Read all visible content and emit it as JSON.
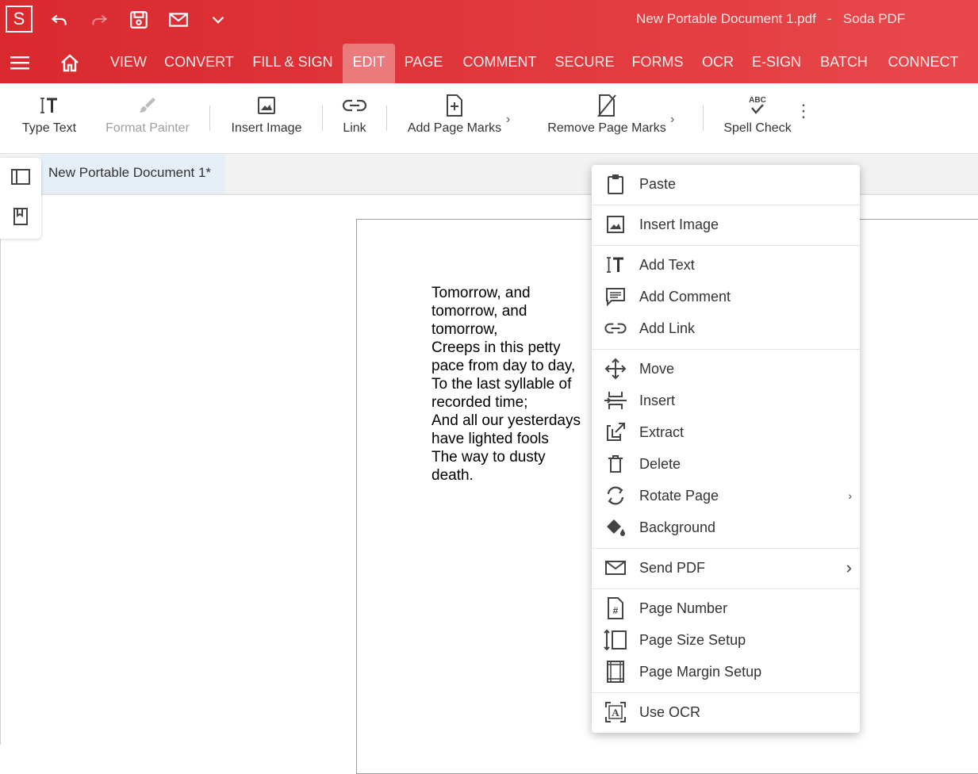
{
  "titlebar": {
    "logo": "S",
    "title": "New Portable Document 1.pdf   -   Soda PDF"
  },
  "tabs": [
    {
      "label": "VIEW"
    },
    {
      "label": "CONVERT"
    },
    {
      "label": "FILL & SIGN"
    },
    {
      "label": "EDIT",
      "active": true
    },
    {
      "label": "PAGE"
    },
    {
      "label": "COMMENT"
    },
    {
      "label": "SECURE"
    },
    {
      "label": "FORMS"
    },
    {
      "label": "OCR"
    },
    {
      "label": "E-SIGN"
    },
    {
      "label": "BATCH"
    },
    {
      "label": "CONNECT"
    }
  ],
  "toolbar": {
    "type_text": "Type Text",
    "format_painter": "Format Painter",
    "insert_image": "Insert Image",
    "link": "Link",
    "add_page_marks": "Add Page Marks",
    "remove_page_marks": "Remove Page Marks",
    "spell_check": "Spell Check",
    "spell_check_icon_text": "ABC"
  },
  "document": {
    "tab_label": "New Portable Document 1*",
    "poem_lines": [
      "Tomorrow, and",
      "tomorrow, and",
      "tomorrow,",
      "Creeps in this petty",
      "pace from day to day,",
      "To the last syllable of",
      "recorded time;",
      "And all our yesterdays",
      "have lighted fools",
      "The way to dusty",
      "death."
    ]
  },
  "context_menu": {
    "paste": "Paste",
    "insert_image": "Insert Image",
    "add_text": "Add Text",
    "add_comment": "Add Comment",
    "add_link": "Add Link",
    "move": "Move",
    "insert": "Insert",
    "extract": "Extract",
    "delete": "Delete",
    "rotate_page": "Rotate Page",
    "background": "Background",
    "send_pdf": "Send PDF",
    "page_number": "Page Number",
    "page_size_setup": "Page Size Setup",
    "page_margin_setup": "Page Margin Setup",
    "use_ocr": "Use OCR",
    "page_number_icon_text": "#",
    "use_ocr_icon_text": "A"
  },
  "colors": {
    "brand_red": "#d9292f",
    "active_tab": "#eb7a7c"
  }
}
